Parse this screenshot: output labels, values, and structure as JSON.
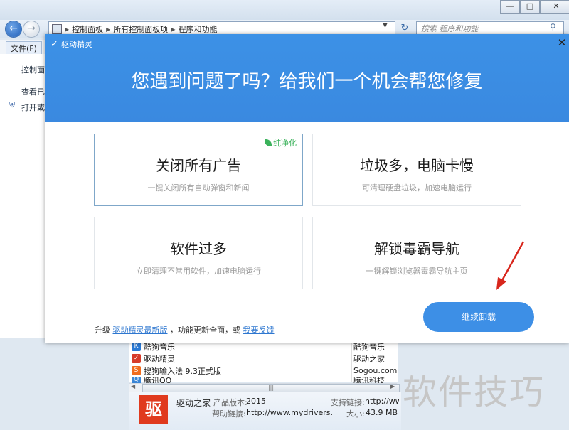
{
  "explorer": {
    "address": [
      "控制面板",
      "所有控制面板项",
      "程序和功能"
    ],
    "search_placeholder": "搜索 程序和功能",
    "menu_file": "文件(F)",
    "left_items": [
      "控制面",
      "查看已",
      "打开或"
    ],
    "caption": {
      "minimize": "—",
      "maximize": "□",
      "close": "✕"
    }
  },
  "programs": {
    "rows": [
      {
        "name": "酷狗音乐",
        "publisher": "酷狗音乐",
        "icon": "kugou-icon",
        "color": "#2a7ad6"
      },
      {
        "name": "驱动精灵",
        "publisher": "驱动之家",
        "icon": "drivergenius-icon",
        "color": "#d63b2a"
      },
      {
        "name": "搜狗输入法 9.3正式版",
        "publisher": "Sogou.com",
        "icon": "sogou-icon",
        "color": "#f06c1e"
      },
      {
        "name": "腾讯QQ",
        "publisher": "腾讯科技",
        "icon": "tencent-icon",
        "color": "#3b86d6"
      }
    ],
    "scroll_grip": "|||"
  },
  "details": {
    "logo_char": "驱",
    "publisher": "驱动之家",
    "version_label": "产品版本:",
    "version": "2015",
    "support_label": "支持链接:",
    "support": "http://www",
    "help_label": "帮助链接:",
    "help": "http://www.mydrivers.",
    "size_label": "大小:",
    "size": "43.9 MB"
  },
  "watermark": "软件技巧",
  "dialog": {
    "app_name": "驱动精灵",
    "close": "✕",
    "headline": "您遇到问题了吗？给我们一个机会帮您修复",
    "cards": [
      {
        "title": "关闭所有广告",
        "subtitle": "一键关闭所有自动弹窗和新闻"
      },
      {
        "title": "垃圾多，电脑卡慢",
        "subtitle": "可清理硬盘垃圾，加速电脑运行"
      },
      {
        "title": "软件过多",
        "subtitle": "立即清理不常用软件，加速电脑运行"
      },
      {
        "title": "解锁毒霸导航",
        "subtitle": "一键解锁浏览器毒霸导航主页"
      }
    ],
    "badge": "纯净化",
    "footer": {
      "prefix": "升级",
      "link1": "驱动精灵最新版",
      "middle": "，功能更新全面，或",
      "link2": "我要反馈"
    },
    "continue_button": "继续卸载"
  },
  "colors": {
    "accent": "#3d8fe6",
    "header": "#3a8ce3",
    "badge": "#3bb25b",
    "arrow": "#d8261c"
  }
}
